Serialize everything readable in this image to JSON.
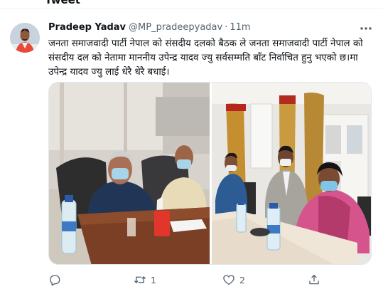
{
  "partial_header": {
    "title": "Tweet"
  },
  "tweet": {
    "author_name": "Pradeep Yadav",
    "handle": "@MP_pradeepyadav",
    "separator": "·",
    "time": "11m",
    "text": "जनता समाजवादी पार्टी नेपाल को संसदीय दलको बैठक ले जनता समाजवादी पार्टी नेपाल को संसदीय दल को नेतामा माननीय उपेन्द्र यादव ज्यु सर्वसम्मति बाँट निर्वाचित हुनु भएको छ।मा उपेन्द्र यादव ज्यु लाई धेरै धेरै बधाई।",
    "media": [
      {
        "kind": "photo",
        "subject": "meeting"
      },
      {
        "kind": "photo",
        "subject": "meeting"
      }
    ],
    "actions": {
      "reply": {
        "icon": "reply-icon",
        "count": ""
      },
      "retweet": {
        "icon": "retweet-icon",
        "count": "1"
      },
      "like": {
        "icon": "heart-icon",
        "count": "2"
      },
      "share": {
        "icon": "share-icon",
        "count": ""
      }
    }
  },
  "colors": {
    "text_primary": "#0f1419",
    "text_secondary": "#536471",
    "divider": "#eff3f4"
  }
}
